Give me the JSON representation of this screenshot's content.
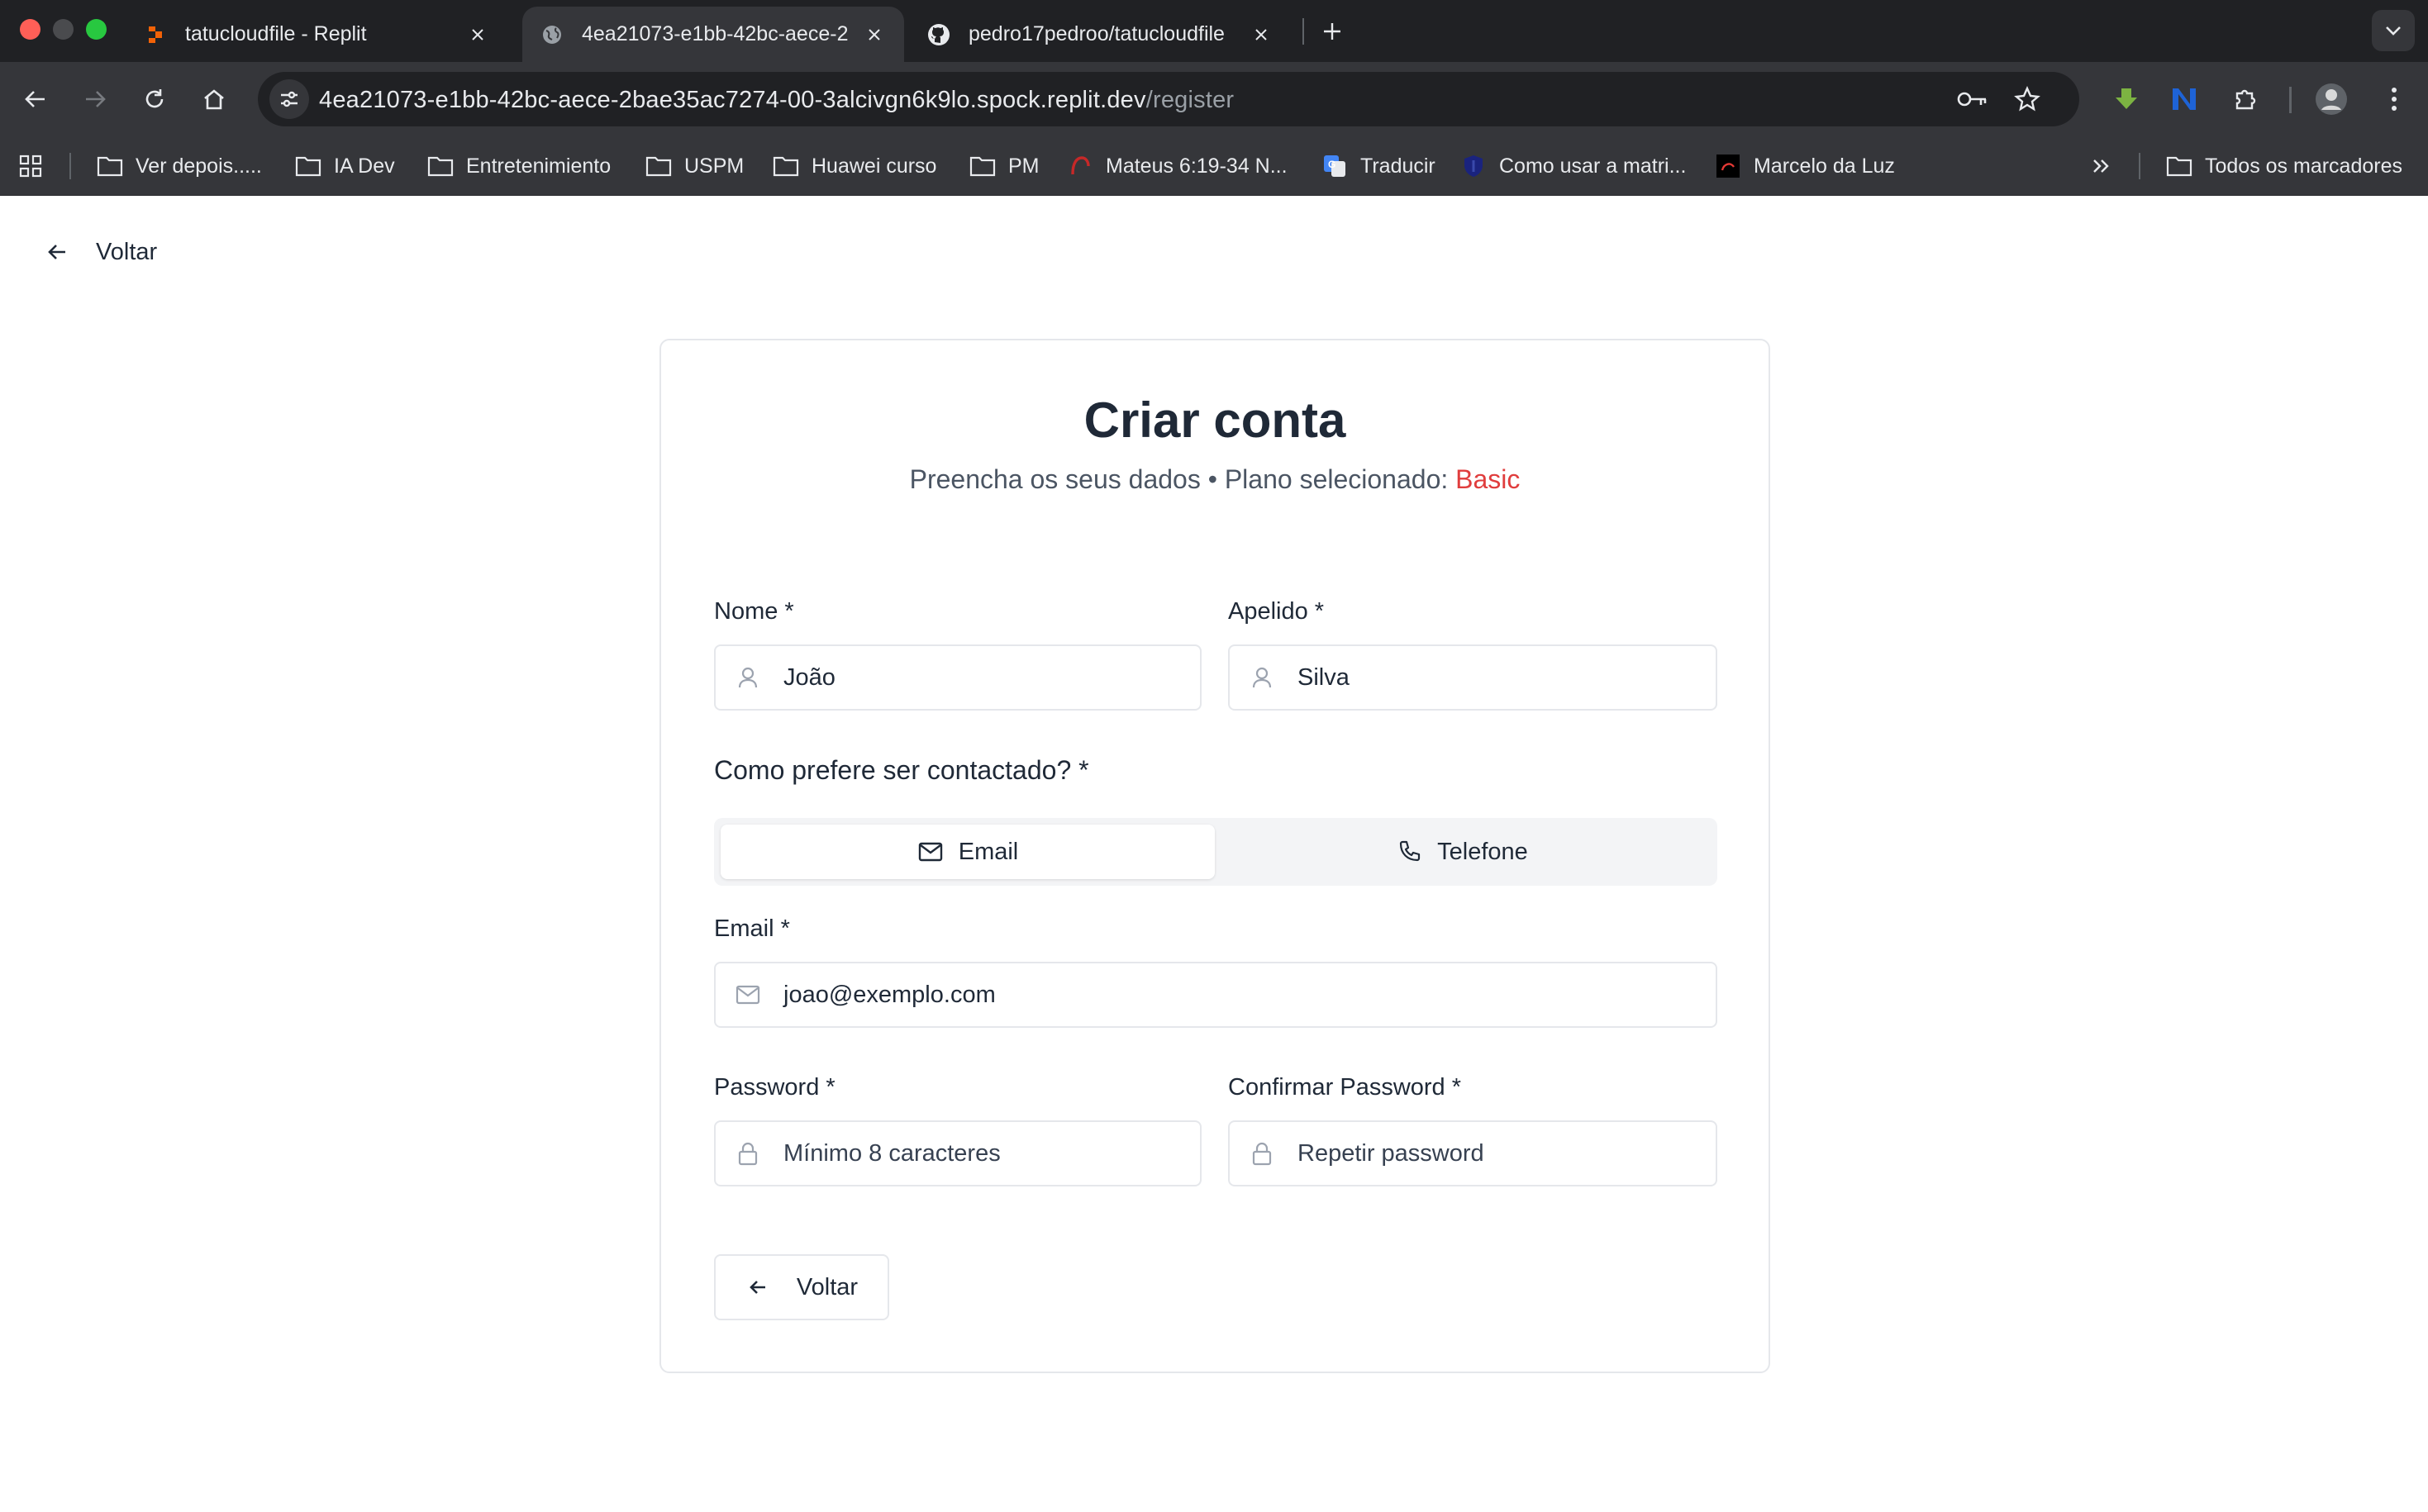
{
  "browser": {
    "tabs": [
      {
        "title": "tatucloudfile - Replit",
        "favicon": "replit-icon",
        "active": false
      },
      {
        "title": "4ea21073-e1bb-42bc-aece-2",
        "favicon": "globe-icon",
        "active": true
      },
      {
        "title": "pedro17pedroo/tatucloudfile",
        "favicon": "github-icon",
        "active": false
      }
    ],
    "url_host": "4ea21073-e1bb-42bc-aece-2bae35ac7274-00-3alcivgn6k9lo.spock.replit.dev",
    "url_path": "/register",
    "bookmarks": [
      {
        "label": "Ver depois.....",
        "icon": "folder-icon"
      },
      {
        "label": "IA Dev",
        "icon": "folder-icon"
      },
      {
        "label": "Entretenimiento",
        "icon": "folder-icon"
      },
      {
        "label": "USPM",
        "icon": "folder-icon"
      },
      {
        "label": "Huawei curso",
        "icon": "folder-icon"
      },
      {
        "label": "PM",
        "icon": "folder-icon"
      },
      {
        "label": "Mateus 6:19-34 N...",
        "icon": "bible-app-icon"
      },
      {
        "label": "Traducir",
        "icon": "google-translate-icon"
      },
      {
        "label": "Como usar a matri...",
        "icon": "shield-icon"
      },
      {
        "label": "Marcelo da Luz",
        "icon": "site-icon"
      }
    ],
    "all_bookmarks": "Todos os marcadores"
  },
  "page": {
    "back_link": "Voltar",
    "title": "Criar conta",
    "subtitle_prefix": "Preencha os seus dados • Plano selecionado: ",
    "plan_name": "Basic",
    "plan_color": "#e03d3d",
    "fields": {
      "first_name": {
        "label": "Nome *",
        "value": "João"
      },
      "last_name": {
        "label": "Apelido *",
        "value": "Silva"
      },
      "email": {
        "label": "Email *",
        "value": "joao@exemplo.com"
      },
      "password": {
        "label": "Password *",
        "placeholder": "Mínimo 8 caracteres"
      },
      "confirm_password": {
        "label": "Confirmar Password *",
        "placeholder": "Repetir password"
      }
    },
    "contact": {
      "label": "Como prefere ser contactado? *",
      "options": [
        {
          "label": "Email",
          "icon": "mail-icon",
          "selected": true
        },
        {
          "label": "Telefone",
          "icon": "phone-icon",
          "selected": false
        }
      ]
    },
    "back_button": "Voltar"
  }
}
